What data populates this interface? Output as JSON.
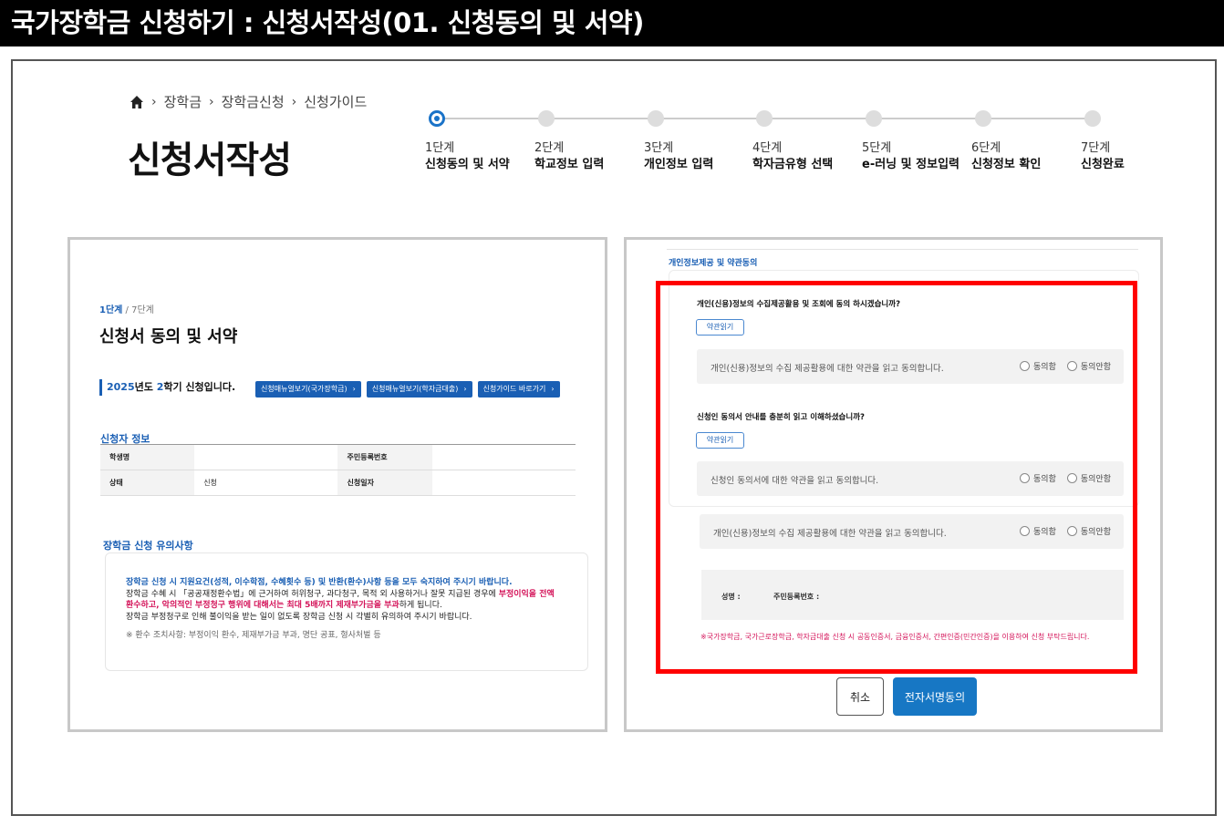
{
  "banner": {
    "title": "국가장학금 신청하기 : 신청서작성(01. 신청동의 및 서약)"
  },
  "header": {
    "breadcrumb": [
      "장학금",
      "장학금신청",
      "신청가이드"
    ],
    "page_title": "신청서작성"
  },
  "steps": [
    {
      "num": "1단계",
      "label": "신청동의 및 서약",
      "active": true
    },
    {
      "num": "2단계",
      "label": "학교정보 입력",
      "active": false
    },
    {
      "num": "3단계",
      "label": "개인정보 입력",
      "active": false
    },
    {
      "num": "4단계",
      "label": "학자금유형 선택",
      "active": false
    },
    {
      "num": "5단계",
      "label": "e-러닝 및 정보입력",
      "active": false
    },
    {
      "num": "6단계",
      "label": "신청정보 확인",
      "active": false
    },
    {
      "num": "7단계",
      "label": "신청완료",
      "active": false
    }
  ],
  "left": {
    "step_current": "1단계",
    "step_total": " / 7단계",
    "form_title": "신청서 동의 및 서약",
    "semester_year": "2025",
    "semester_mid": "년도 ",
    "semester_term": "2",
    "semester_tail": "학기 신청입니다.",
    "guide_buttons": [
      "신청매뉴얼보기(국가장학금)",
      "신청매뉴얼보기(학자금대출)",
      "신청가이드 바로가기"
    ],
    "applicant_title": "신청자 정보",
    "table": {
      "name_label": "학생명",
      "name_value": "",
      "rrn_label": "주민등록번호",
      "rrn_value": "",
      "status_label": "상태",
      "status_value": "신청",
      "date_label": "신청일자",
      "date_value": ""
    },
    "notice_title": "장학금 신청 유의사항",
    "notice": {
      "line1": "장학금 신청 시 지원요건(성적, 이수학점, 수혜횟수 등) 및 반환(환수)사항 등을 모두 숙지하여 주시기 바랍니다.",
      "line2a": "장학금 수혜 시 「공공재정환수법」에 근거하여 허위청구, 과다청구, 목적 외 사용하거나 잘못 지급된 경우에 ",
      "line2b": "부정이익을 전액",
      "line3a": "환수하고, 악의적인 부정청구 행위에 대해서는 최대 5배까지 제재부가금을 부과",
      "line3b": "하게 됩니다.",
      "line4": "장학금 부정청구로 인해 불이익을 받는 일이 없도록 장학금 신청 시 각별히 유의하여 주시기 바랍니다.",
      "line5": "※ 환수 조치사항: 부정이익 환수, 제재부가금 부과, 명단 공표, 형사처벌 등"
    }
  },
  "right": {
    "section_title": "개인정보제공 및 약관동의",
    "q1": "개인(신용)정보의 수집제공활용 및 조회에 동의 하시겠습니까?",
    "q2": "신청인 동의서 안내를 충분히 읽고 이해하셨습니까?",
    "terms_button": "약관읽기",
    "consent1": "개인(신용)정보의 수집 제공활용에 대한 약관을 읽고 동의합니다.",
    "consent2": "신청인 동의서에 대한 약관을 읽고 동의합니다.",
    "consent3": "개인(신용)정보의 수집 제공활용에 대한 약관을 읽고 동의합니다.",
    "agree": "동의함",
    "disagree": "동의안함",
    "sign_name_label": "성명 :",
    "sign_rrn_label": "주민등록번호 :",
    "warning": "※국가장학금, 국가근로장학금, 학자금대출 신청 시 공동인증서, 금융인증서, 간편인증(민간인증)을 이용하여 신청 부탁드립니다.",
    "cancel": "취소",
    "sign_button": "전자서명동의"
  },
  "colors": {
    "accent": "#1a5fb4",
    "highlight": "#ff0000",
    "warning": "#d4145a",
    "button": "#1777c4"
  }
}
